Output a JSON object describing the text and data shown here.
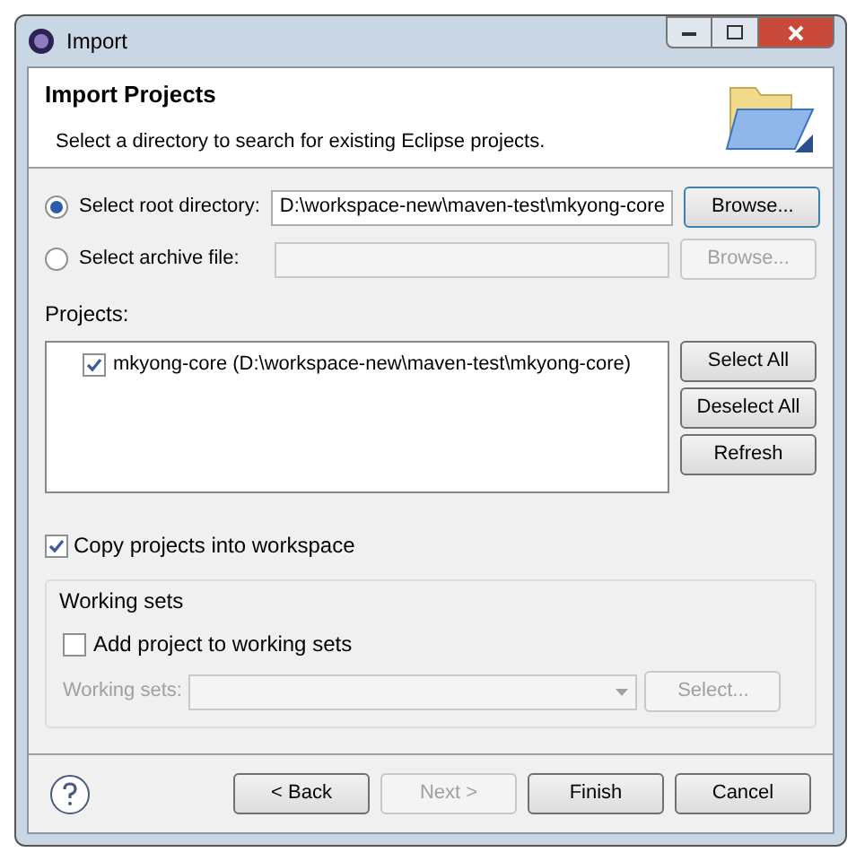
{
  "window": {
    "title": "Import"
  },
  "header": {
    "title": "Import Projects",
    "description": "Select a directory to search for existing Eclipse projects."
  },
  "source_options": [
    {
      "label": "Select root directory:",
      "selected": true,
      "value": "D:\\workspace-new\\maven-test\\mkyong-core",
      "button": "Browse...",
      "disabled": false
    },
    {
      "label": "Select archive file:",
      "selected": false,
      "button": "Browse...",
      "disabled": true
    }
  ],
  "projects": {
    "label": "Projects:",
    "items": [
      {
        "label": "mkyong-core (D:\\workspace-new\\maven-test\\mkyong-core)",
        "checked": true
      }
    ],
    "buttons": [
      "Select All",
      "Deselect All",
      "Refresh"
    ]
  },
  "copy_option": {
    "label": "Copy projects into workspace",
    "checked": true
  },
  "working_sets": {
    "title": "Working sets",
    "add_option": {
      "label": "Add project to working sets",
      "checked": false
    },
    "field_label": "Working sets:",
    "button": "Select...",
    "disabled": true
  },
  "footer_buttons": [
    {
      "label": "< Back",
      "disabled": false
    },
    {
      "label": "Next >",
      "disabled": true
    },
    {
      "label": "Finish",
      "disabled": false
    },
    {
      "label": "Cancel",
      "disabled": false
    }
  ]
}
